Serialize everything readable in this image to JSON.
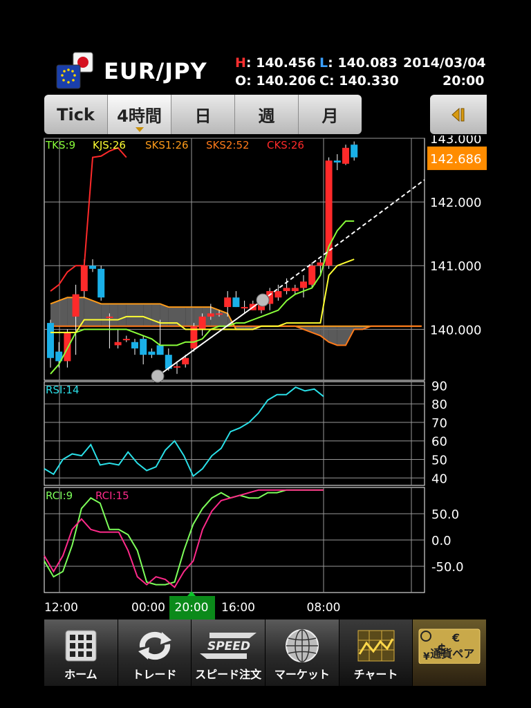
{
  "header": {
    "pair": "EUR/JPY",
    "high_label": "H",
    "high_value": ": 140.456",
    "low_label": "L",
    "low_value": ": 140.083",
    "open_label": "O",
    "open_value": ": 140.206",
    "close_label": "C",
    "close_value": ": 140.330",
    "date": "2014/03/04",
    "time": "20:00",
    "colors": {
      "high": "#ff3030",
      "low": "#3aa0ff"
    }
  },
  "timeframes": [
    {
      "label": "Tick",
      "selected": false
    },
    {
      "label": "4時間",
      "selected": true
    },
    {
      "label": "日",
      "selected": false
    },
    {
      "label": "週",
      "selected": false
    },
    {
      "label": "月",
      "selected": false
    }
  ],
  "collapse_icon": "collapse-panel-icon",
  "tabbar": [
    {
      "label": "ホーム",
      "icon": "grid-home-icon"
    },
    {
      "label": "トレード",
      "icon": "refresh-arrows-icon"
    },
    {
      "label": "スピード注文",
      "icon": "speed-icon",
      "icon_text": "SPEED"
    },
    {
      "label": "マーケット",
      "icon": "globe-icon"
    },
    {
      "label": "チャート",
      "icon": "chart-icon",
      "selected": true
    },
    {
      "label": "通貨ペア",
      "icon": "currency-pair-icon",
      "icon_symbols": [
        "€",
        "$",
        "¥"
      ]
    }
  ],
  "chart_data": [
    {
      "type": "candlestick",
      "title": "EUR/JPY 4時間",
      "indicators": [
        {
          "label": "TKS:9",
          "color": "#8aff3a"
        },
        {
          "label": "KJS:26",
          "color": "#ffff33"
        },
        {
          "label": "SKS1:26",
          "color": "#ff9c1a"
        },
        {
          "label": "SKS2:52",
          "color": "#ff7a1a"
        },
        {
          "label": "CKS:26",
          "color": "#ff2a2a"
        }
      ],
      "current_price": "142.686",
      "y_ticks": [
        "143.000",
        "142.000",
        "141.000",
        "140.000"
      ],
      "ylim": [
        139.2,
        143.0
      ],
      "x_ticks": [
        "12:00",
        "00:00",
        "20:00",
        "16:00",
        "08:00"
      ],
      "candles": [
        {
          "o": 140.1,
          "h": 140.15,
          "l": 139.4,
          "c": 139.55
        },
        {
          "o": 139.65,
          "h": 139.8,
          "l": 139.4,
          "c": 139.5
        },
        {
          "o": 139.5,
          "h": 140.0,
          "l": 139.4,
          "c": 139.95
        },
        {
          "o": 140.2,
          "h": 140.7,
          "l": 139.6,
          "c": 140.55
        },
        {
          "o": 140.6,
          "h": 141.1,
          "l": 140.5,
          "c": 141.0
        },
        {
          "o": 141.0,
          "h": 141.1,
          "l": 140.9,
          "c": 140.95
        },
        {
          "o": 140.95,
          "h": 141.0,
          "l": 140.45,
          "c": 140.5
        },
        {
          "o": 140.2,
          "h": 140.25,
          "l": 139.7,
          "c": 140.2
        },
        {
          "o": 139.75,
          "h": 140.0,
          "l": 139.7,
          "c": 139.8
        },
        {
          "o": 139.85,
          "h": 139.9,
          "l": 139.8,
          "c": 139.85
        },
        {
          "o": 139.8,
          "h": 139.85,
          "l": 139.6,
          "c": 139.7
        },
        {
          "o": 139.85,
          "h": 139.9,
          "l": 139.45,
          "c": 139.6
        },
        {
          "o": 139.65,
          "h": 139.7,
          "l": 139.55,
          "c": 139.6
        },
        {
          "o": 139.75,
          "h": 140.15,
          "l": 139.6,
          "c": 139.6
        },
        {
          "o": 139.6,
          "h": 139.7,
          "l": 139.35,
          "c": 139.38
        },
        {
          "o": 139.4,
          "h": 139.5,
          "l": 139.3,
          "c": 139.42
        },
        {
          "o": 139.45,
          "h": 139.6,
          "l": 139.4,
          "c": 139.55
        },
        {
          "o": 139.7,
          "h": 140.1,
          "l": 139.65,
          "c": 140.05
        },
        {
          "o": 140.0,
          "h": 140.25,
          "l": 139.9,
          "c": 140.2
        },
        {
          "o": 140.2,
          "h": 140.4,
          "l": 140.15,
          "c": 140.25
        },
        {
          "o": 140.25,
          "h": 140.3,
          "l": 140.2,
          "c": 140.25
        },
        {
          "o": 140.35,
          "h": 140.6,
          "l": 140.2,
          "c": 140.5
        },
        {
          "o": 140.5,
          "h": 140.6,
          "l": 140.35,
          "c": 140.35
        },
        {
          "o": 140.35,
          "h": 140.45,
          "l": 140.25,
          "c": 140.35
        },
        {
          "o": 140.3,
          "h": 140.45,
          "l": 140.3,
          "c": 140.4
        },
        {
          "o": 140.3,
          "h": 140.5,
          "l": 140.25,
          "c": 140.45
        },
        {
          "o": 140.4,
          "h": 140.65,
          "l": 140.3,
          "c": 140.6
        },
        {
          "o": 140.5,
          "h": 140.7,
          "l": 140.45,
          "c": 140.6
        },
        {
          "o": 140.6,
          "h": 140.8,
          "l": 140.55,
          "c": 140.65
        },
        {
          "o": 140.6,
          "h": 140.7,
          "l": 140.55,
          "c": 140.65
        },
        {
          "o": 140.65,
          "h": 140.85,
          "l": 140.5,
          "c": 140.75
        },
        {
          "o": 140.7,
          "h": 141.05,
          "l": 140.65,
          "c": 141.0
        },
        {
          "o": 141.0,
          "h": 141.1,
          "l": 140.85,
          "c": 141.05
        },
        {
          "o": 141.0,
          "h": 142.7,
          "l": 140.95,
          "c": 142.65
        },
        {
          "o": 142.65,
          "h": 142.75,
          "l": 142.5,
          "c": 142.62
        },
        {
          "o": 142.6,
          "h": 142.9,
          "l": 142.58,
          "c": 142.85
        },
        {
          "o": 142.9,
          "h": 142.95,
          "l": 142.65,
          "c": 142.7
        }
      ],
      "tenkan": [
        139.3,
        139.45,
        139.7,
        139.95,
        140.0,
        140.0,
        140.0,
        140.0,
        140.0,
        140.0,
        139.95,
        139.9,
        139.85,
        139.75,
        139.75,
        139.75,
        139.8,
        139.8,
        139.85,
        140.0,
        140.05,
        140.05,
        140.1,
        140.1,
        140.15,
        140.2,
        140.25,
        140.3,
        140.45,
        140.55,
        140.6,
        140.65,
        140.85,
        141.3,
        141.55,
        141.7,
        141.7
      ],
      "kijun": [
        139.95,
        139.95,
        139.95,
        139.95,
        140.15,
        140.15,
        140.15,
        140.15,
        140.15,
        140.2,
        140.2,
        140.2,
        140.15,
        140.1,
        140.1,
        140.1,
        140.0,
        140.0,
        140.0,
        140.0,
        140.0,
        140.0,
        140.0,
        140.0,
        140.0,
        140.05,
        140.05,
        140.05,
        140.1,
        140.1,
        140.1,
        140.1,
        140.1,
        140.85,
        141.0,
        141.05,
        141.1
      ],
      "span_a": [
        140.4,
        140.45,
        140.5,
        140.5,
        140.5,
        140.45,
        140.4,
        140.4,
        140.4,
        140.4,
        140.4,
        140.4,
        140.4,
        140.4,
        140.35,
        140.35,
        140.35,
        140.35,
        140.35,
        140.35,
        140.3,
        140.25,
        140.0,
        140.0,
        140.0,
        140.05,
        140.05,
        140.05,
        140.05,
        140.05,
        140.05,
        140.05,
        140.05,
        140.05,
        140.05,
        140.05,
        140.05,
        140.05,
        140.05,
        140.05,
        140.05,
        140.05,
        140.05,
        140.05,
        140.05,
        140.05,
        140.05,
        140.05,
        140.05,
        140.05,
        140.05,
        140.05,
        140.05,
        140.05,
        140.0,
        139.95,
        139.95,
        140.0,
        140.1,
        140.05,
        140.0,
        139.95,
        139.9,
        139.95,
        139.95,
        140.0
      ],
      "span_b": [
        140.05,
        140.05,
        140.05,
        140.05,
        140.05,
        140.05,
        140.05,
        140.05,
        140.05,
        140.05,
        140.05,
        140.05,
        140.05,
        140.05,
        140.05,
        140.05,
        140.05,
        140.05,
        140.05,
        140.05,
        140.05,
        140.05,
        140.05,
        140.05,
        140.05,
        140.05,
        140.05,
        140.05,
        140.05,
        140.05,
        140.0,
        139.95,
        139.9,
        139.8,
        139.75,
        139.75,
        140.0,
        140.0,
        140.05,
        140.05,
        140.05,
        140.05,
        140.05,
        140.05,
        140.05,
        140.05,
        140.05,
        140.05,
        140.05,
        140.05,
        140.05,
        140.05,
        140.05,
        140.05,
        140.0,
        139.95,
        139.95,
        140.0,
        140.1,
        140.05,
        140.0,
        139.95,
        139.9,
        139.95,
        139.95,
        140.0
      ],
      "chikou": [
        140.6,
        140.7,
        140.9,
        141.0,
        141.0,
        142.7,
        142.72,
        142.8,
        142.85,
        142.7
      ],
      "trendline": {
        "x": [
          13,
          45
        ],
        "y": [
          139.3,
          143.0
        ]
      }
    },
    {
      "type": "line",
      "title": "RSI:14",
      "y_ticks": [
        "90",
        "80",
        "70",
        "60",
        "50",
        "40"
      ],
      "ylim": [
        36,
        92
      ],
      "values": [
        45,
        42,
        50,
        53,
        52,
        58,
        47,
        48,
        47,
        54,
        48,
        44,
        46,
        55,
        60,
        52,
        41,
        45,
        52,
        56,
        65,
        67,
        70,
        75,
        82,
        85,
        85,
        89,
        87,
        88,
        84
      ]
    },
    {
      "type": "line",
      "title": "RCI",
      "y_ticks": [
        "50.0",
        "0.0",
        "-50.0"
      ],
      "ylim": [
        -100,
        100
      ],
      "series": [
        {
          "name": "RCI:9",
          "color": "#7dff5a",
          "values": [
            -40,
            -70,
            -60,
            -10,
            60,
            80,
            70,
            20,
            20,
            10,
            -20,
            -80,
            -85,
            -85,
            -80,
            -20,
            30,
            60,
            80,
            90,
            80,
            85,
            80,
            80,
            90,
            90,
            95,
            95,
            95,
            95,
            95
          ]
        },
        {
          "name": "RCI:15",
          "color": "#ff2a8a",
          "values": [
            -30,
            -60,
            -30,
            20,
            40,
            20,
            15,
            15,
            15,
            -20,
            -70,
            -85,
            -70,
            -75,
            -90,
            -60,
            -40,
            20,
            55,
            75,
            80,
            85,
            90,
            95,
            95,
            95,
            95,
            95,
            95,
            95,
            95
          ]
        }
      ]
    }
  ]
}
